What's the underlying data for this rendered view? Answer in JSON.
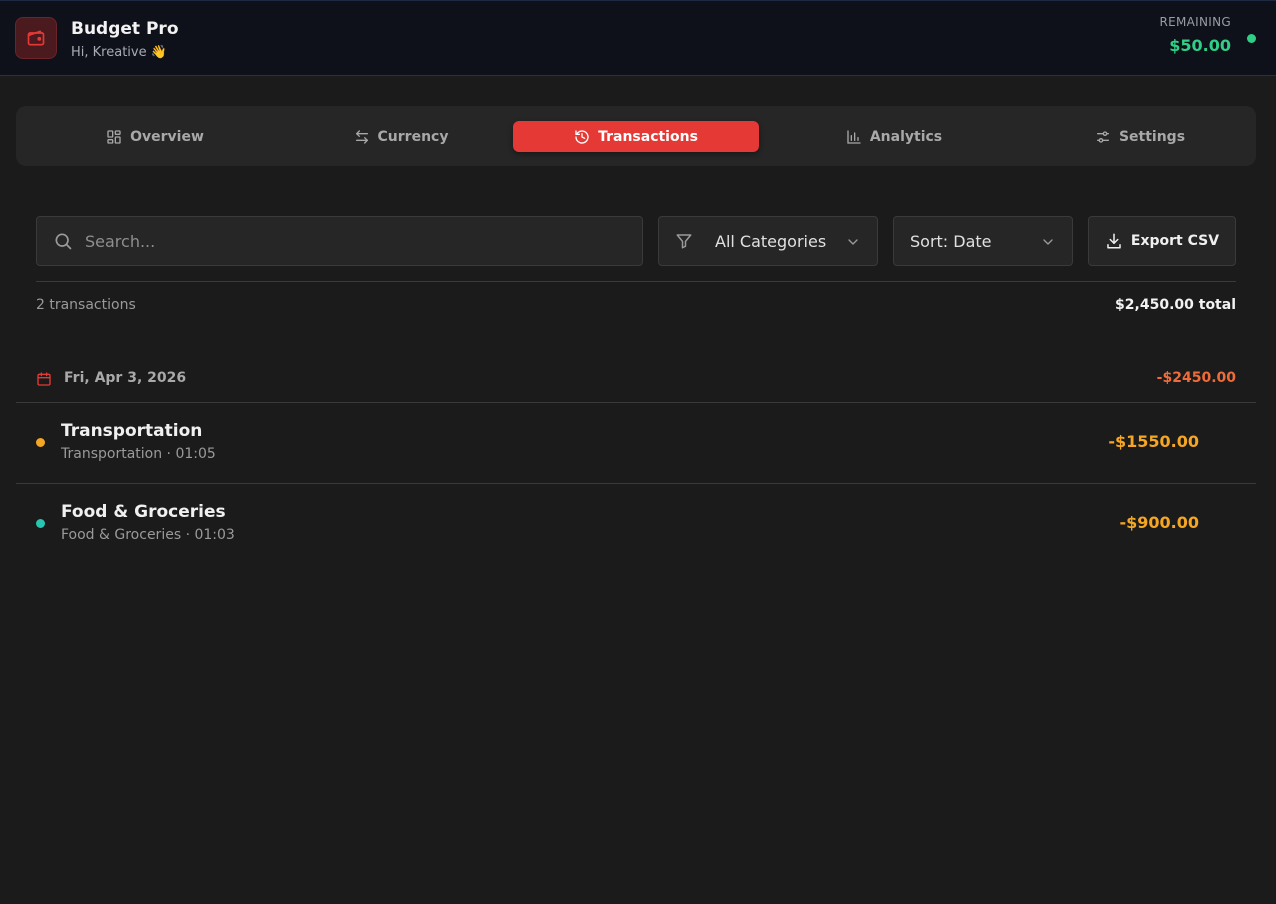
{
  "header": {
    "app_title": "Budget Pro",
    "greeting": "Hi, Kreative 👋",
    "remaining_label": "REMAINING",
    "remaining_value": "$50.00",
    "logo_icon": "wallet-icon",
    "status_color": "#2fcf86"
  },
  "nav": {
    "tabs": [
      {
        "label": "Overview",
        "icon": "grid-icon",
        "active": false
      },
      {
        "label": "Currency",
        "icon": "swap-arrows-icon",
        "active": false
      },
      {
        "label": "Transactions",
        "icon": "history-icon",
        "active": true
      },
      {
        "label": "Analytics",
        "icon": "bar-chart-icon",
        "active": false
      },
      {
        "label": "Settings",
        "icon": "sliders-icon",
        "active": false
      }
    ],
    "active_color": "#e53935"
  },
  "filters": {
    "search_placeholder": "Search...",
    "category_selected": "All Categories",
    "sort_selected": "Sort: Date",
    "export_label": "Export CSV"
  },
  "summary": {
    "count": "2 transactions",
    "total": "$2,450.00 total"
  },
  "groups": [
    {
      "date": "Fri, Apr 3, 2026",
      "total": "-$2450.00",
      "transactions": [
        {
          "name": "Transportation",
          "detail": "Transportation · 01:05",
          "amount": "-$1550.00",
          "color": "#f5a623"
        },
        {
          "name": "Food & Groceries",
          "detail": "Food & Groceries · 01:03",
          "amount": "-$900.00",
          "color": "#26c6b0"
        }
      ]
    }
  ]
}
